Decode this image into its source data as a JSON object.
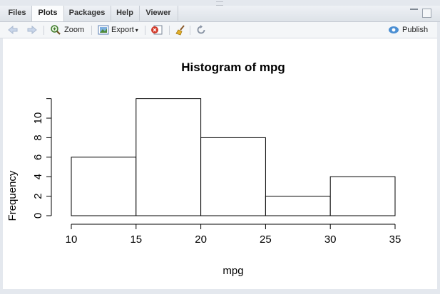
{
  "tabs": [
    {
      "label": "Files"
    },
    {
      "label": "Plots"
    },
    {
      "label": "Packages"
    },
    {
      "label": "Help"
    },
    {
      "label": "Viewer"
    }
  ],
  "toolbar": {
    "zoom_label": "Zoom",
    "export_label": "Export",
    "publish_label": "Publish"
  },
  "chart_data": {
    "type": "bar",
    "title": "Histogram of mpg",
    "xlabel": "mpg",
    "ylabel": "Frequency",
    "bins": [
      [
        10,
        15
      ],
      [
        15,
        20
      ],
      [
        20,
        25
      ],
      [
        25,
        30
      ],
      [
        30,
        35
      ]
    ],
    "values": [
      6,
      12,
      8,
      2,
      4
    ],
    "xlim": [
      10,
      35
    ],
    "ylim": [
      0,
      12
    ],
    "xticks": [
      "10",
      "15",
      "20",
      "25",
      "30",
      "35"
    ],
    "yticks": [
      "0",
      "2",
      "4",
      "6",
      "8",
      "10"
    ],
    "grid": false
  }
}
